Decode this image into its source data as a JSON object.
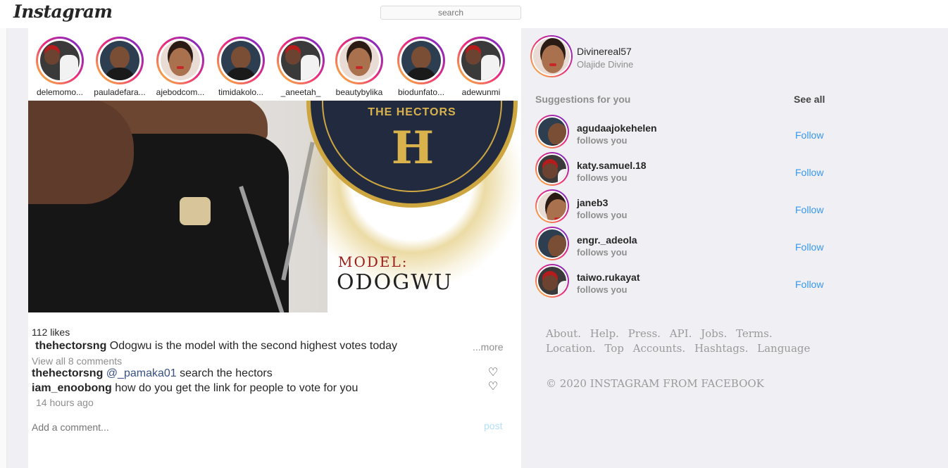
{
  "header": {
    "logo": "Instagram",
    "search_placeholder": "search"
  },
  "stories": [
    {
      "name": "delemomo...",
      "avatar": "group"
    },
    {
      "name": "pauladefara...",
      "avatar": "man"
    },
    {
      "name": "ajebodcom...",
      "avatar": "woman"
    },
    {
      "name": "timidakolo...",
      "avatar": "man"
    },
    {
      "name": "_aneetah_",
      "avatar": "group"
    },
    {
      "name": "beautybylika",
      "avatar": "woman"
    },
    {
      "name": "biodunfato...",
      "avatar": "man"
    },
    {
      "name": "adewunmi",
      "avatar": "group"
    }
  ],
  "post": {
    "image_text": {
      "badge": "THE HECTORS",
      "model_label": "MODEL:",
      "model_name": "ODOGWU"
    },
    "likes": "112 likes",
    "caption_user": "thehectorsng",
    "caption_text": "Odogwu is the model with the second highest votes today",
    "more": "...more",
    "view_comments": "View all 8 comments",
    "comments": [
      {
        "user": "thehectorsng",
        "mention": "@_pamaka01",
        "text": "search the hectors"
      },
      {
        "user": "iam_enoobong",
        "mention": "",
        "text": "how do you get the link for people to vote for you"
      }
    ],
    "time": "14 hours ago",
    "add_comment_placeholder": "Add a comment...",
    "post_label": "post"
  },
  "sidebar": {
    "username": "Divinereal57",
    "fullname": "Olajide Divine",
    "suggestions_title": "Suggestions for you",
    "see_all": "See all",
    "suggestions": [
      {
        "username": "agudaajokehelen",
        "sub": "follows you",
        "action": "Follow",
        "avatar": "man"
      },
      {
        "username": "katy.samuel.18",
        "sub": "follows you",
        "action": "Follow",
        "avatar": "group"
      },
      {
        "username": "janeb3",
        "sub": "follows you",
        "action": "Follow",
        "avatar": "woman"
      },
      {
        "username": "engr._adeola",
        "sub": "follows you",
        "action": "Follow",
        "avatar": "man"
      },
      {
        "username": "taiwo.rukayat",
        "sub": "follows you",
        "action": "Follow",
        "avatar": "group"
      }
    ],
    "footer_links": [
      "About.",
      "Help.",
      "Press.",
      "API.",
      "Jobs.",
      "Terms.",
      "Location.",
      "Top",
      "Accounts.",
      "Hashtags.",
      "Language"
    ],
    "copyright": "© 2020 INSTAGRAM FROM FACEBOOK"
  }
}
